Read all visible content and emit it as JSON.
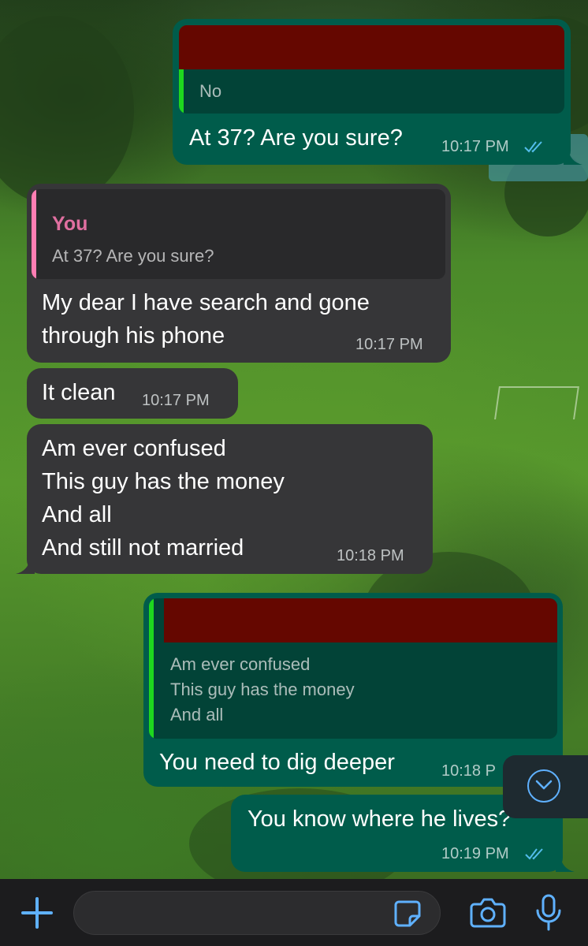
{
  "chat": {
    "messages": [
      {
        "id": "m1",
        "direction": "outgoing",
        "text": "At 37? Are you sure?",
        "time": "10:17 PM",
        "status": "read",
        "quote": {
          "author_redacted": true,
          "text": "No"
        }
      },
      {
        "id": "m2",
        "direction": "incoming",
        "text": "My dear I have search and gone\nthrough his phone",
        "time": "10:17 PM",
        "quote": {
          "author": "You",
          "text": "At 37? Are you sure?"
        }
      },
      {
        "id": "m3",
        "direction": "incoming",
        "text": "It clean",
        "time": "10:17 PM"
      },
      {
        "id": "m4",
        "direction": "incoming",
        "text": "Am ever confused\nThis guy has the money\nAnd all\nAnd still not married",
        "time": "10:18 PM"
      },
      {
        "id": "m5",
        "direction": "outgoing",
        "text": "You need to dig deeper",
        "time": "10:18 P",
        "quote": {
          "author_redacted": true,
          "text": "Am ever confused\nThis guy has the money\nAnd all"
        }
      },
      {
        "id": "m6",
        "direction": "outgoing",
        "text": "You know where he lives?",
        "time": "10:19 PM",
        "status": "read"
      }
    ]
  },
  "composer": {
    "placeholder": "",
    "value": "",
    "icons": {
      "attach": "plus-icon",
      "sticker": "sticker-icon",
      "camera": "camera-icon",
      "mic": "microphone-icon"
    }
  },
  "colors": {
    "outgoing_bubble": "#005c4b",
    "incoming_bubble": "#363638",
    "quote_bar_outgoing": "#1ed71e",
    "quote_bar_incoming": "#ff7eb3",
    "quote_author_you": "#e06fa0",
    "read_ticks": "#53bdeb",
    "accent_blue": "#5fb1ff",
    "redaction": "#650700"
  }
}
